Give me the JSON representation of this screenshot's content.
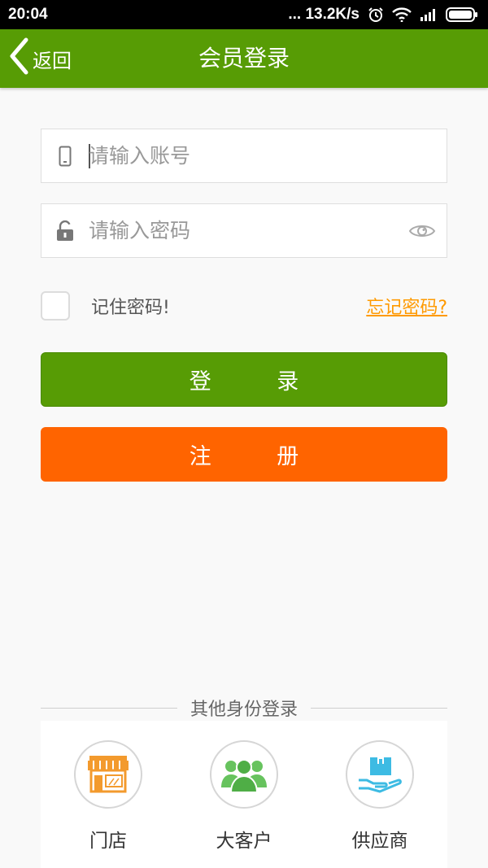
{
  "status_bar": {
    "time": "20:04",
    "network_speed": "... 13.2K/s"
  },
  "header": {
    "back_label": "返回",
    "title": "会员登录"
  },
  "login_form": {
    "account_placeholder": "请输入账号",
    "password_placeholder": "请输入密码",
    "remember_label": "记住密码!",
    "remember_checked": false,
    "forgot_label": "忘记密码?"
  },
  "buttons": {
    "login_label": "登 录",
    "register_label": "注 册"
  },
  "other_identities": {
    "heading": "其他身份登录",
    "items": [
      {
        "label": "门店",
        "icon": "store-icon"
      },
      {
        "label": "大客户",
        "icon": "group-icon"
      },
      {
        "label": "供应商",
        "icon": "supplier-box-icon"
      }
    ]
  },
  "colors": {
    "brand_green": "#579c05",
    "register_orange": "#ff6400",
    "forgot_link": "#ff9a00"
  }
}
